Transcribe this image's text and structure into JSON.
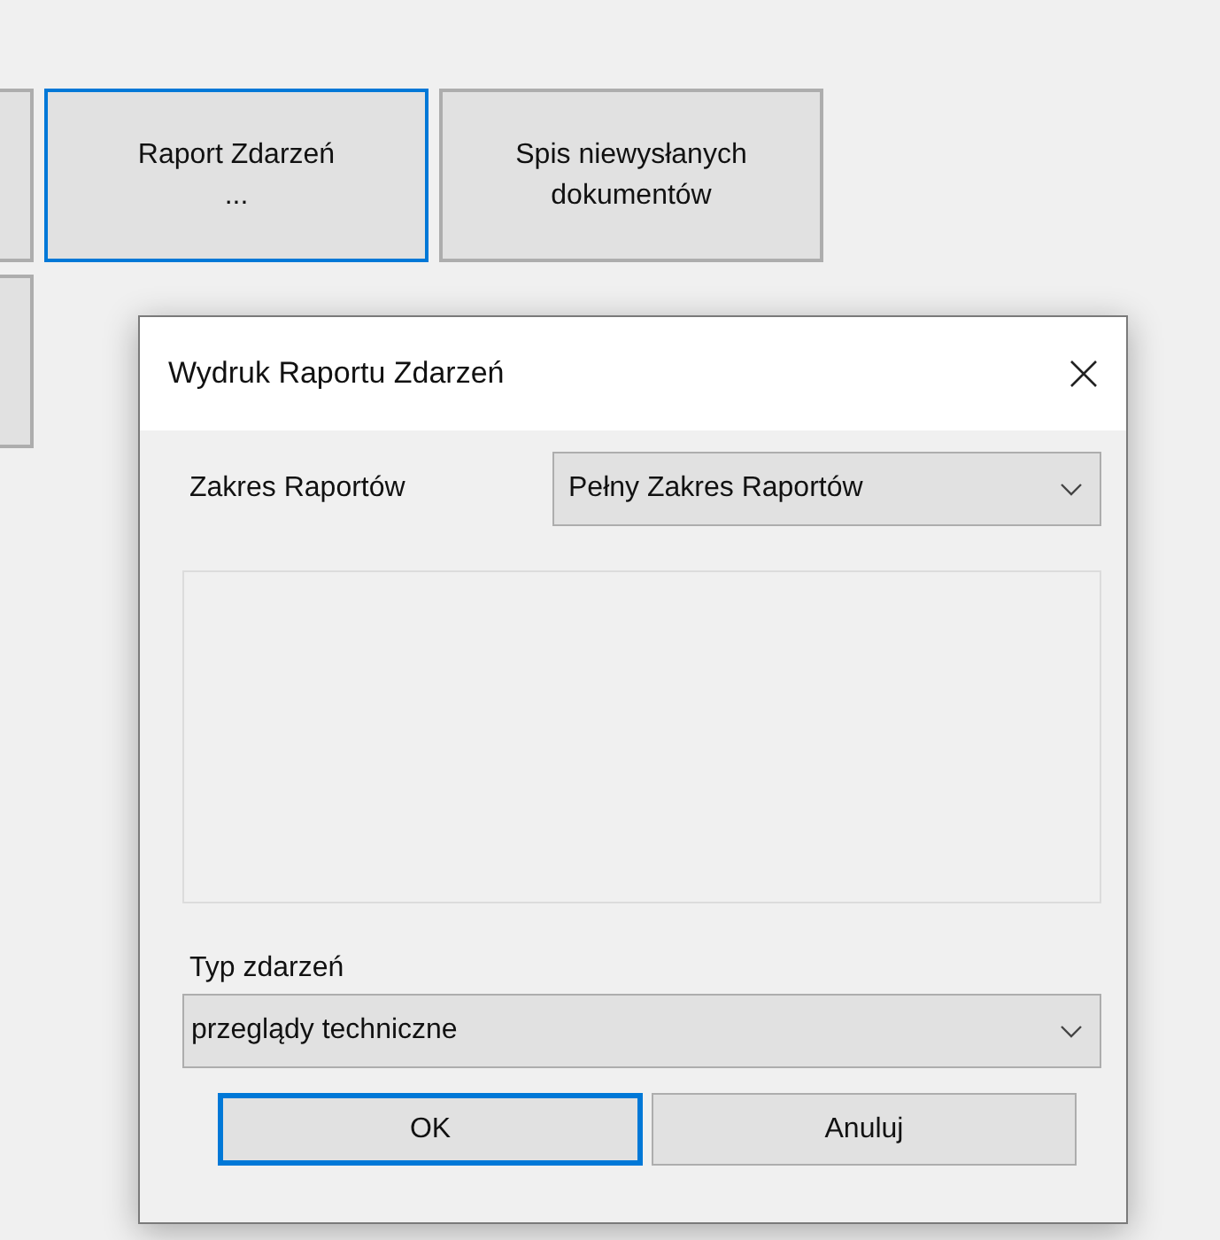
{
  "background_buttons": [
    {
      "focused": false,
      "cut": true
    },
    {
      "label": "Raport Zdarzeń\n...",
      "focused": true,
      "cut": false
    },
    {
      "label": "Spis niewysłanych\ndokumentów",
      "focused": false,
      "cut": false
    }
  ],
  "background_buttons_row2": [
    {
      "focused": false,
      "cut": true
    }
  ],
  "dialog": {
    "title": "Wydruk Raportu Zdarzeń",
    "report_range": {
      "label": "Zakres Raportów",
      "value": "Pełny Zakres Raportów"
    },
    "event_type": {
      "label": "Typ zdarzeń",
      "value": "przeglądy techniczne"
    },
    "buttons": [
      {
        "label": "OK",
        "focused": true
      },
      {
        "label": "Anuluj",
        "focused": false
      }
    ]
  }
}
